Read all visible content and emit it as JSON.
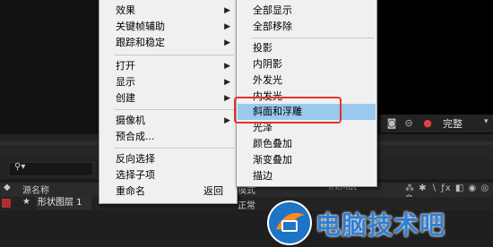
{
  "menu1": {
    "items": [
      {
        "label": "效果",
        "submenu": true
      },
      {
        "label": "关键帧辅助",
        "submenu": true
      },
      {
        "label": "跟踪和稳定",
        "submenu": true
      },
      {
        "label": "打开",
        "submenu": true
      },
      {
        "label": "显示",
        "submenu": true
      },
      {
        "label": "创建",
        "submenu": true
      },
      {
        "label": "摄像机",
        "submenu": true
      },
      {
        "label": "预合成..."
      },
      {
        "label": "反向选择"
      },
      {
        "label": "选择子项"
      },
      {
        "label": "重命名",
        "shortcut": "返回"
      }
    ]
  },
  "menu2": {
    "items": [
      {
        "label": "全部显示"
      },
      {
        "label": "全部移除"
      },
      {
        "label": "投影"
      },
      {
        "label": "内阴影"
      },
      {
        "label": "外发光"
      },
      {
        "label": "内发光"
      },
      {
        "label": "斜面和浮雕",
        "highlighted": true
      },
      {
        "label": "光泽"
      },
      {
        "label": "颜色叠加"
      },
      {
        "label": "渐变叠加"
      },
      {
        "label": "描边"
      }
    ]
  },
  "viewer_toolbar": {
    "quality": "完整"
  },
  "timeline": {
    "search_placeholder": "",
    "columns": {
      "source_name": "源名称",
      "mode": "模式",
      "trkmat": "TrkMat"
    },
    "layer": {
      "name": "形状图层 1",
      "mode": "正常"
    }
  },
  "watermark": {
    "text": "电脑技术吧"
  },
  "colors": {
    "menu_highlight": "#99c9ef",
    "annotation_box": "#e53328",
    "layer_label": "#b03030",
    "watermark": "#2d7fd6"
  }
}
